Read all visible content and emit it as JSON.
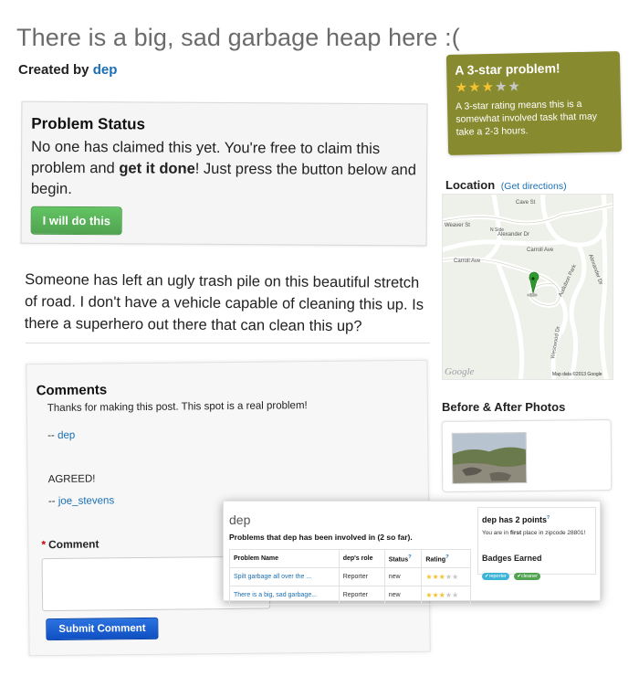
{
  "problem": {
    "title": "There is a big, sad garbage heap here :(",
    "created_by_prefix": "Created by",
    "created_by_user": "dep",
    "description": "Someone has left an ugly trash pile on this beautiful stretch of road. I don't have a vehicle capable of cleaning this up. Is there a superhero out there that can clean this up?"
  },
  "status": {
    "heading": "Problem Status",
    "text_before": "No one has claimed this yet. You're free to claim this problem and",
    "text_bold": "get it done",
    "text_after": "! Just press the button below and begin.",
    "button_label": "I will do this"
  },
  "rating": {
    "title": "A 3-star problem!",
    "stars": 3,
    "max_stars": 5,
    "description": "A 3-star rating means this is a somewhat involved task that may take a 2-3 hours.",
    "colors": {
      "box": "#888a2f",
      "star_on": "#f2c230",
      "star_off": "#c7c7c7"
    }
  },
  "location": {
    "title": "Location",
    "link": "(Get directions)",
    "map_labels": {
      "street_1": "Cave St",
      "street_2": "Weaver St",
      "street_3": "Alexander Dr",
      "street_4": "Carroll Ave",
      "street_5": "Carroll Ave",
      "street_6": "Alexander Dr",
      "street_7": "Audubon Park",
      "street_8": "Westwood Dr",
      "poi": "N Side",
      "logo": "Google",
      "credit": "Map data ©2013 Google"
    }
  },
  "photos": {
    "title": "Before & After Photos"
  },
  "comments": {
    "heading": "Comments",
    "items": [
      {
        "text": "Thanks for making this post. This spot is a real problem!",
        "prefix": "--",
        "author": "dep"
      },
      {
        "text": "AGREED!",
        "prefix": "--",
        "author": "joe_stevens"
      }
    ],
    "form_label": "Comment",
    "required_marker": "*",
    "submit_label": "Submit Comment"
  },
  "profile": {
    "name": "dep",
    "subtitle": "Problems that dep has been involved in (2 so far).",
    "columns": [
      "Problem Name",
      "dep's role",
      "Status",
      "Rating"
    ],
    "column_help": "?",
    "rows": [
      {
        "name": "Spilt garbage all over the ...",
        "role": "Reporter",
        "status": "new",
        "stars": 3
      },
      {
        "name": "There is a big, sad garbage...",
        "role": "Reporter",
        "status": "new",
        "stars": 3
      }
    ],
    "points_title": "dep has 2 points",
    "points_help": "?",
    "points_text_before": "You are in",
    "points_text_bold": "first",
    "points_text_after": "place in zipcode 28801!",
    "badges_title": "Badges Earned",
    "badges": [
      {
        "label": "reporter",
        "color": "#3cb4d8"
      },
      {
        "label": "cleaner",
        "color": "#51a351"
      }
    ]
  }
}
